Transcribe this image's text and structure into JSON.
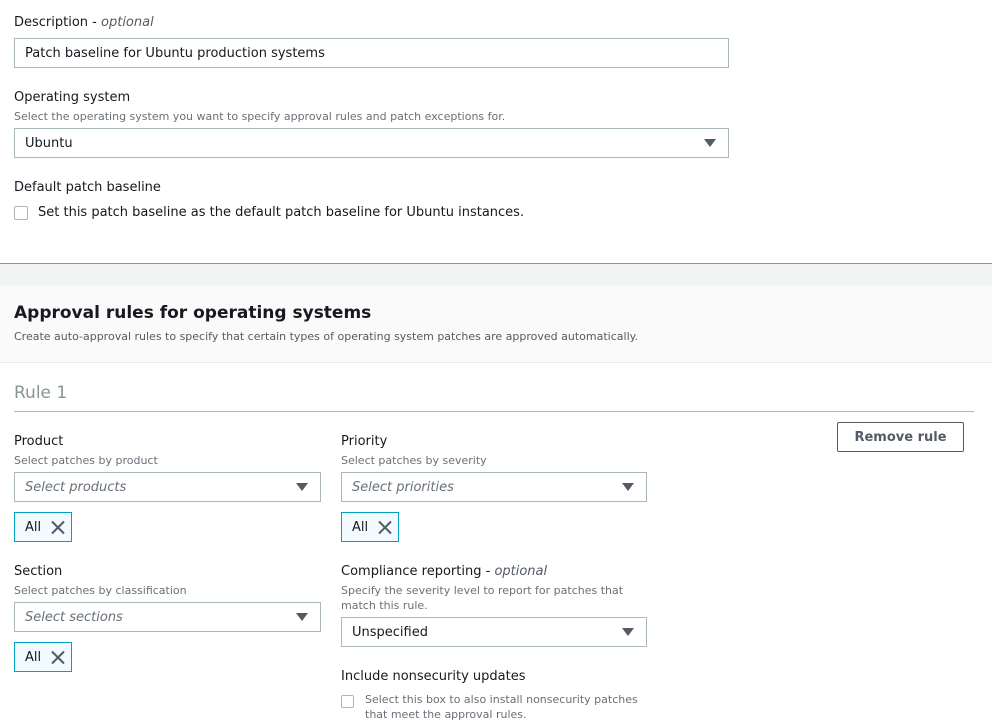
{
  "description": {
    "label": "Description",
    "optional": "optional",
    "value": "Patch baseline for Ubuntu production systems"
  },
  "operating_system": {
    "label": "Operating system",
    "hint": "Select the operating system you want to specify approval rules and patch exceptions for.",
    "value": "Ubuntu"
  },
  "default_baseline": {
    "label": "Default patch baseline",
    "checkbox_label": "Set this patch baseline as the default patch baseline for Ubuntu instances.",
    "checked": false
  },
  "approval_rules": {
    "title": "Approval rules for operating systems",
    "subtitle": "Create auto-approval rules to specify that certain types of operating system patches are approved automatically."
  },
  "rule": {
    "title": "Rule 1",
    "remove_label": "Remove rule",
    "product": {
      "label": "Product",
      "hint": "Select patches by product",
      "placeholder": "Select products",
      "token": "All"
    },
    "priority": {
      "label": "Priority",
      "hint": "Select patches by severity",
      "placeholder": "Select priorities",
      "token": "All"
    },
    "section": {
      "label": "Section",
      "hint": "Select patches by classification",
      "placeholder": "Select sections",
      "token": "All"
    },
    "compliance": {
      "label": "Compliance reporting",
      "optional": "optional",
      "hint": "Specify the severity level to report for patches that match this rule.",
      "value": "Unspecified"
    },
    "nonsecurity": {
      "label": "Include nonsecurity updates",
      "checkbox_label": "Select this box to also install nonsecurity patches that meet the approval rules.",
      "checked": false
    }
  },
  "colors": {
    "token_border": "#00a1c9",
    "token_bg": "#f1faff",
    "section_bg": "#f8f8f8",
    "divider": "#879596"
  }
}
